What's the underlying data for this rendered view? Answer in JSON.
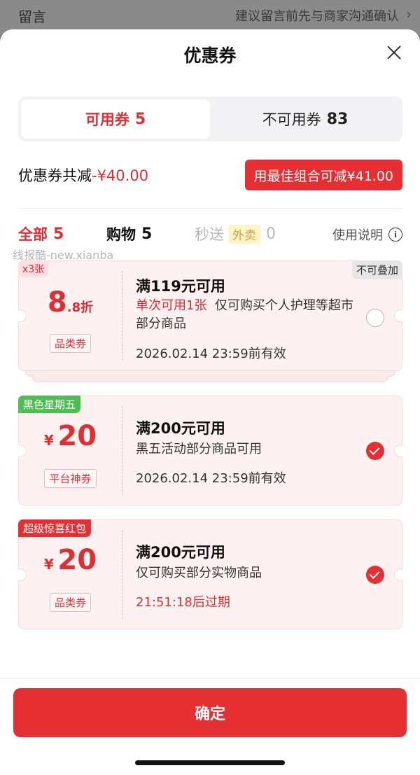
{
  "backdrop": {
    "left_text": "留言",
    "right_text": "建议留言前先与商家沟通确认"
  },
  "sheet": {
    "title": "优惠券"
  },
  "tabs": [
    {
      "label": "可用券",
      "count": "5"
    },
    {
      "label": "不可用券",
      "count": "83"
    }
  ],
  "summary": {
    "label": "优惠券共减",
    "amount": "-¥40.00",
    "best_button": "用最佳组合可减¥41.00"
  },
  "filters": {
    "all": {
      "label": "全部",
      "count": "5"
    },
    "shopping": {
      "label": "购物",
      "count": "5"
    },
    "fast": {
      "label": "秒送",
      "badge": "外卖",
      "count": "0"
    },
    "usage": "使用说明"
  },
  "watermark": "线报酷-new.xianba",
  "coupons": [
    {
      "tag": "x3张",
      "no_stack": "不可叠加",
      "value_main": "8",
      "value_sub": ".8折",
      "category": "品类券",
      "title": "满119元可用",
      "desc_highlight": "单次可用1张",
      "desc": "仅可购买个人护理等超市部分商品",
      "expiry": "2026.02.14 23:59前有效",
      "selected": false
    },
    {
      "tag": "黑色星期五",
      "currency": "¥",
      "value_main": "20",
      "category": "平台神券",
      "title": "满200元可用",
      "desc": "黑五活动部分商品可用",
      "expiry": "2026.02.14 23:59前有效",
      "selected": true
    },
    {
      "tag": "超级惊喜红包",
      "currency": "¥",
      "value_main": "20",
      "category": "品类券",
      "title": "满200元可用",
      "desc": "仅可购买部分实物商品",
      "expiry": "21:51:18后过期",
      "selected": true
    }
  ],
  "confirm": "确定",
  "colors": {
    "accent": "#e62f32",
    "tag_green": "#4cbe52",
    "coupon_bg": "#fdf1f1"
  }
}
